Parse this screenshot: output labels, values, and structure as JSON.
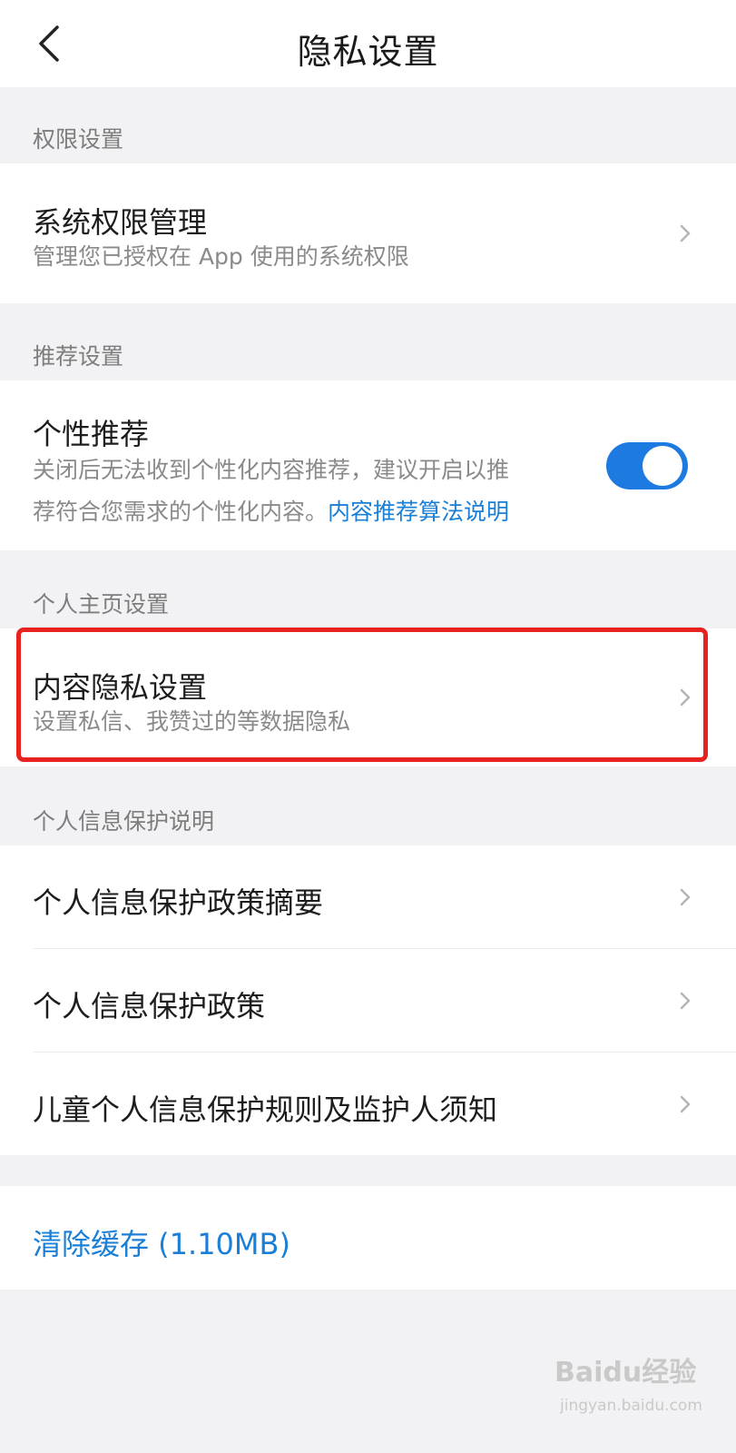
{
  "header": {
    "title": "隐私设置"
  },
  "sections": {
    "permissions": {
      "label": "权限设置",
      "item": {
        "title": "系统权限管理",
        "subtitle": "管理您已授权在 App 使用的系统权限"
      }
    },
    "recommendation": {
      "label": "推荐设置",
      "item": {
        "title": "个性推荐",
        "desc_line1": "关闭后无法收到个性化内容推荐，建议开启以推",
        "desc_line2": "荐符合您需求的个性化内容。",
        "link": "内容推荐算法说明",
        "toggle_on": true
      }
    },
    "homepage": {
      "label": "个人主页设置",
      "item": {
        "title": "内容隐私设置",
        "subtitle": "设置私信、我赞过的等数据隐私"
      }
    },
    "info_protection": {
      "label": "个人信息保护说明",
      "items": [
        {
          "title": "个人信息保护政策摘要"
        },
        {
          "title": "个人信息保护政策"
        },
        {
          "title": "儿童个人信息保护规则及监护人须知"
        }
      ]
    }
  },
  "clear_cache": {
    "label": "清除缓存 (1.10MB)"
  },
  "watermark": {
    "brand": "Baidu经验",
    "sub": "jingyan.baidu.com"
  },
  "colors": {
    "accent": "#1a7fd6",
    "toggle": "#1d7ae0",
    "highlight": "#e8231f",
    "background": "#f2f2f4"
  },
  "icons": {
    "back": "back-arrow-icon",
    "chevron": "chevron-right-icon"
  }
}
